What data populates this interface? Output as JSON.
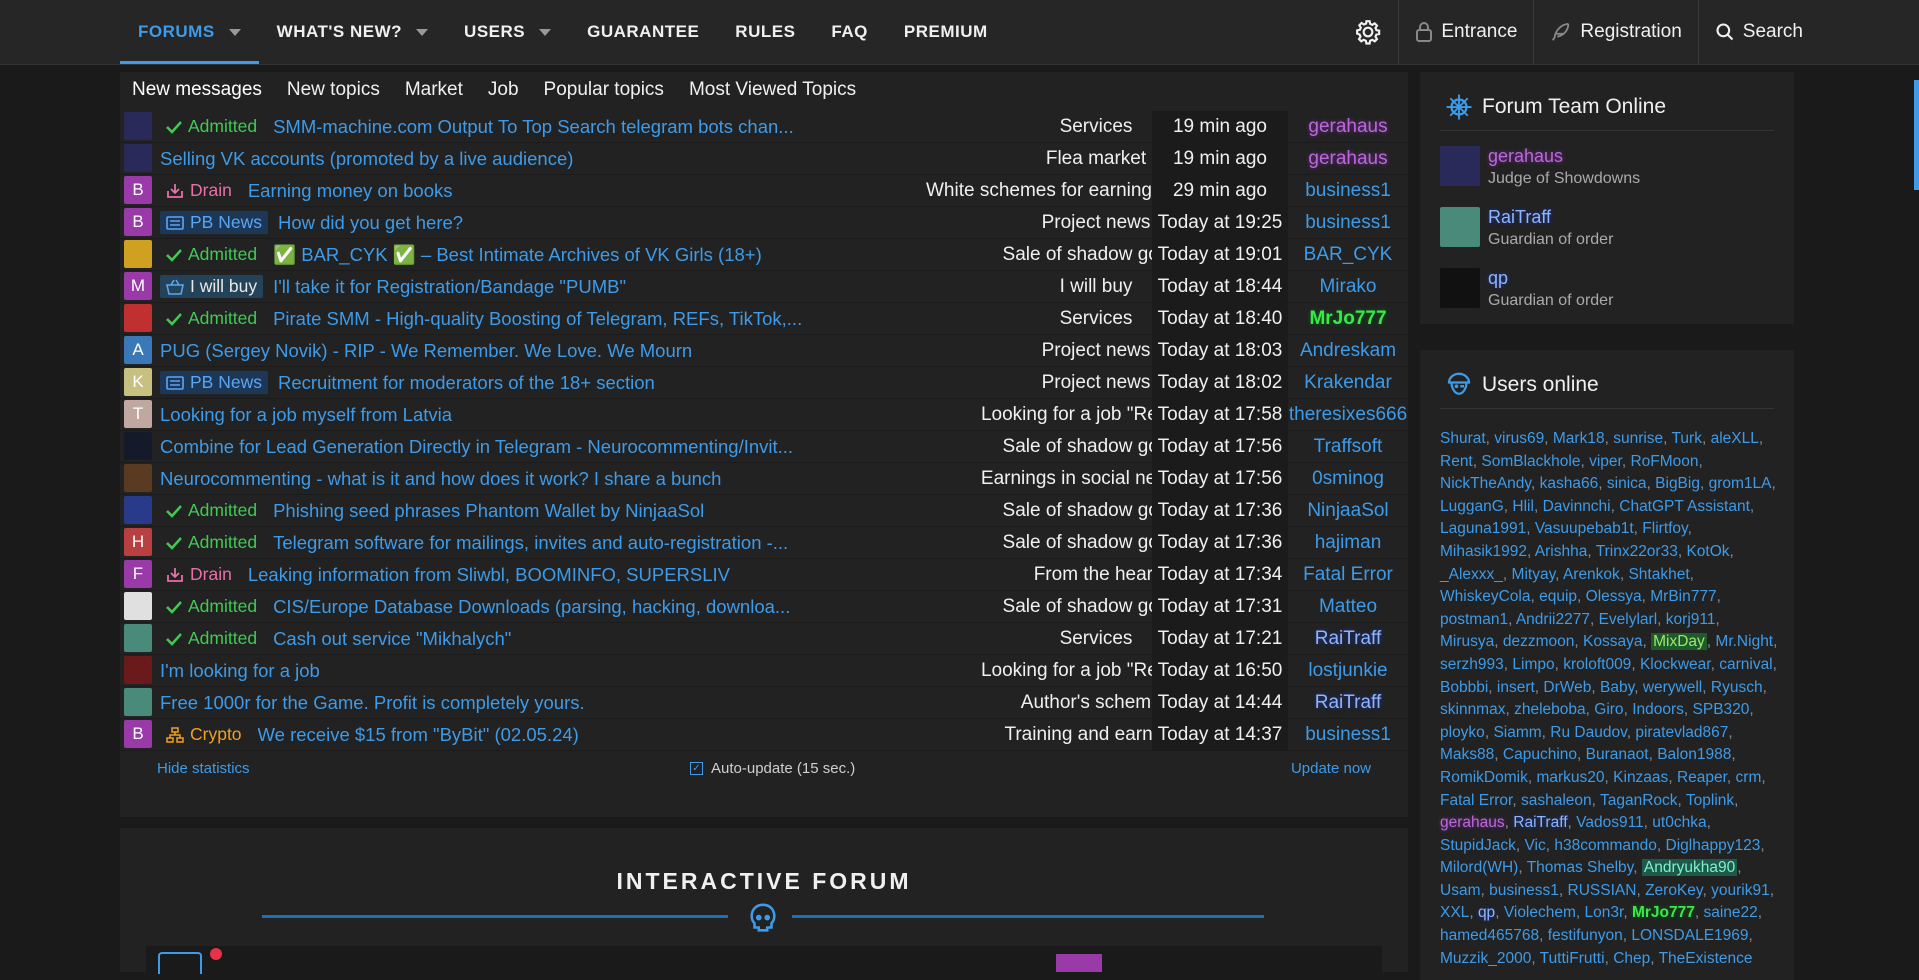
{
  "nav": {
    "items": [
      {
        "label": "FORUMS",
        "caret": true,
        "active": true
      },
      {
        "label": "WHAT'S NEW?",
        "caret": true
      },
      {
        "label": "USERS",
        "caret": true
      },
      {
        "label": "GUARANTEE"
      },
      {
        "label": "RULES"
      },
      {
        "label": "FAQ"
      },
      {
        "label": "PREMIUM"
      }
    ],
    "entrance": "Entrance",
    "registration": "Registration",
    "search": "Search"
  },
  "tabs": [
    "New messages",
    "New topics",
    "Market",
    "Job",
    "Popular topics",
    "Most Viewed Topics"
  ],
  "threads": [
    {
      "avatar": "",
      "avatar_color": "#2a2a5a",
      "prefix": "Admitted",
      "prefix_type": "admitted",
      "title": "SMM-machine.com Output To Top Search telegram bots chan...",
      "forum": "Services",
      "time": "19 min ago",
      "user": "gerahaus",
      "user_style": "purple"
    },
    {
      "avatar": "",
      "avatar_color": "#2a2a5a",
      "prefix": "",
      "prefix_type": "",
      "title": "Selling VK accounts (promoted by a live audience)",
      "forum": "Flea market",
      "time": "19 min ago",
      "user": "gerahaus",
      "user_style": "purple"
    },
    {
      "avatar": "B",
      "avatar_color": "#9a3aa8",
      "prefix": "Drain",
      "prefix_type": "drain",
      "title": "Earning money on books",
      "forum": "White schemes for earning money online",
      "time": "29 min ago",
      "user": "business1",
      "user_style": ""
    },
    {
      "avatar": "B",
      "avatar_color": "#9a3aa8",
      "prefix": "PB News",
      "prefix_type": "pb",
      "title": "How did you get here?",
      "forum": "Project news",
      "time": "Today at 19:25",
      "user": "business1",
      "user_style": ""
    },
    {
      "avatar": "",
      "avatar_color": "#d0a020",
      "prefix": "Admitted",
      "prefix_type": "admitted",
      "title": "✅ BAR_CYK ✅ – Best Intimate Archives of VK Girls (18+)",
      "forum": "Sale of shadow goods",
      "time": "Today at 19:01",
      "user": "BAR_CYK",
      "user_style": ""
    },
    {
      "avatar": "M",
      "avatar_color": "#9a3aa8",
      "prefix": "I will buy",
      "prefix_type": "buy",
      "title": "I'll take it for Registration/Bandage \"PUMB\"",
      "forum": "I will buy",
      "time": "Today at 18:44",
      "user": "Mirako",
      "user_style": ""
    },
    {
      "avatar": "",
      "avatar_color": "#c03030",
      "prefix": "Admitted",
      "prefix_type": "admitted",
      "title": "Pirate SMM - High-quality Boosting of Telegram, REFs, TikTok,...",
      "forum": "Services",
      "time": "Today at 18:40",
      "user": "MrJo777",
      "user_style": "green"
    },
    {
      "avatar": "A",
      "avatar_color": "#3a78b8",
      "prefix": "",
      "prefix_type": "",
      "title": "PUG (Sergey Novik) - RIP - We Remember. We Love. We Mourn",
      "forum": "Project news",
      "time": "Today at 18:03",
      "user": "Andreskam",
      "user_style": ""
    },
    {
      "avatar": "K",
      "avatar_color": "#c8c080",
      "prefix": "PB News",
      "prefix_type": "pb",
      "title": "Recruitment for moderators of the 18+ section",
      "forum": "Project news",
      "time": "Today at 18:02",
      "user": "Krakendar",
      "user_style": ""
    },
    {
      "avatar": "T",
      "avatar_color": "#c0a8a0",
      "prefix": "",
      "prefix_type": "",
      "title": "Looking for a job myself from Latvia",
      "forum": "Looking for a job \"Resume\"",
      "time": "Today at 17:58",
      "user": "theresixes666",
      "user_style": ""
    },
    {
      "avatar": "",
      "avatar_color": "#151a2a",
      "prefix": "",
      "prefix_type": "",
      "title": "Combine for Lead Generation Directly in Telegram - Neurocommenting/Invit...",
      "forum": "Sale of shadow goods",
      "time": "Today at 17:56",
      "user": "Traffsoft",
      "user_style": ""
    },
    {
      "avatar": "",
      "avatar_color": "#5a3a20",
      "prefix": "",
      "prefix_type": "",
      "title": "Neurocommenting - what is it and how does it work? I share a bunch",
      "forum": "Earnings in social networks",
      "time": "Today at 17:56",
      "user": "0sminog",
      "user_style": ""
    },
    {
      "avatar": "",
      "avatar_color": "#2a3a8a",
      "prefix": "Admitted",
      "prefix_type": "admitted",
      "title": "Phishing seed phrases Phantom Wallet by NinjaaSol",
      "forum": "Sale of shadow goods",
      "time": "Today at 17:36",
      "user": "NinjaaSol",
      "user_style": ""
    },
    {
      "avatar": "H",
      "avatar_color": "#b84040",
      "prefix": "Admitted",
      "prefix_type": "admitted",
      "title": "Telegram software for mailings, invites and auto-registration -...",
      "forum": "Sale of shadow goods",
      "time": "Today at 17:36",
      "user": "hajiman",
      "user_style": ""
    },
    {
      "avatar": "F",
      "avatar_color": "#9a3aa8",
      "prefix": "Drain",
      "prefix_type": "drain",
      "title": "Leaking information from Sliwbl, BOOMINFO, SUPERSLIV",
      "forum": "From the heart",
      "time": "Today at 17:34",
      "user": "Fatal Error",
      "user_style": ""
    },
    {
      "avatar": "",
      "avatar_color": "#e0e0e0",
      "prefix": "Admitted",
      "prefix_type": "admitted",
      "title": "CIS/Europe Database Downloads (parsing, hacking, downloa...",
      "forum": "Sale of shadow goods",
      "time": "Today at 17:31",
      "user": "Matteo",
      "user_style": ""
    },
    {
      "avatar": "",
      "avatar_color": "#4a8a7a",
      "prefix": "Admitted",
      "prefix_type": "admitted",
      "title": "Cash out service \"Mikhalych\"",
      "forum": "Services",
      "time": "Today at 17:21",
      "user": "RaiTraff",
      "user_style": "navy"
    },
    {
      "avatar": "",
      "avatar_color": "#6a1a1a",
      "prefix": "",
      "prefix_type": "",
      "title": "I'm looking for a job",
      "forum": "Looking for a job \"Resume\"",
      "time": "Today at 16:50",
      "user": "lostjunkie",
      "user_style": ""
    },
    {
      "avatar": "",
      "avatar_color": "#4a8a7a",
      "prefix": "",
      "prefix_type": "",
      "title": "Free 1000r for the Game. Profit is completely yours.",
      "forum": "Author's schemes",
      "time": "Today at 14:44",
      "user": "RaiTraff",
      "user_style": "navy"
    },
    {
      "avatar": "B",
      "avatar_color": "#9a3aa8",
      "prefix": "Crypto",
      "prefix_type": "crypto",
      "title": "We receive $15 from \"ByBit\" (02.05.24)",
      "forum": "Training and earnings",
      "time": "Today at 14:37",
      "user": "business1",
      "user_style": ""
    }
  ],
  "stats": {
    "hide": "Hide statistics",
    "auto_update": "Auto-update (15 sec.)",
    "update_now": "Update now"
  },
  "interactive": {
    "heading": "INTERACTIVE FORUM"
  },
  "team": {
    "title": "Forum Team Online",
    "members": [
      {
        "name": "gerahaus",
        "role": "Judge of Showdowns",
        "style": "purple",
        "avatar_color": "#2a2a5a"
      },
      {
        "name": "RaiTraff",
        "role": "Guardian of order",
        "style": "navy",
        "avatar_color": "#4a8a7a"
      },
      {
        "name": "qp",
        "role": "Guardian of order",
        "style": "navy",
        "avatar_color": "#111111"
      }
    ]
  },
  "online": {
    "title": "Users online",
    "users": [
      "Shurat",
      "virus69",
      "Mark18",
      "sunrise",
      "Turk",
      "aleXLL",
      "Rent",
      "SomBlackhole",
      "viper",
      "RoFMoon",
      "NickTheAndy",
      "kasha66",
      "sinica",
      "BigBig",
      "grom1LA",
      "LugganG",
      "Hlil",
      "Davinnchi",
      "ChatGPT Assistant",
      "Laguna1991",
      "Vasuupebab1t",
      "Flirtfoy",
      "Mihasik1992",
      "Arishha",
      "Trinx22or33",
      "KotOk",
      "_Alexxx_",
      "Mityay",
      "Arenkok",
      "Shtakhet",
      "WhiskeyCola",
      "equip",
      "Olessya",
      "MrBin777",
      "postman1",
      "Andrii2277",
      "Evelylarl",
      "korj911",
      "Mirusya",
      "dezzmoon",
      "Kossaya",
      "MixDay",
      "Mr.Night",
      "serzh993",
      "Limpo",
      "kroloft009",
      "Klockwear",
      "carnival",
      "Bobbbi",
      "insert",
      "DrWeb",
      "Baby",
      "werywell",
      "Ryusch",
      "skinnmax",
      "zheleboba",
      "Giro",
      "Indoors",
      "SPB320",
      "ployko",
      "Siamm",
      "Ru Daudov",
      "piratevlad867",
      "Maks88",
      "Capuchino",
      "Buranaot",
      "Balon1988",
      "RomikDomik",
      "markus20",
      "Kinzaas",
      "Reaper",
      "crm",
      "Fatal Error",
      "sashaleon",
      "TaganRock",
      "Toplink",
      "gerahaus",
      "RaiTraff",
      "Vados911",
      "ut0chka",
      "StupidJack",
      "Vic",
      "h38commando",
      "Diglhappy123",
      "Milord(WH)",
      "Thomas Shelby",
      "Andryukha90",
      "Usam",
      "business1",
      "RUSSIAN",
      "ZeroKey",
      "yourik91",
      "XXL",
      "qp",
      "Violechem",
      "Lon3r",
      "MrJo777",
      "saine22",
      "hamed465768",
      "festifunyon",
      "LONSDALE1969",
      "Muzzik_2000",
      "TuttiFrutti",
      "Chep",
      "TheExistence"
    ],
    "styled": {
      "MixDay": "mix",
      "gerahaus": "purple",
      "RaiTraff": "navy",
      "Andryukha90": "andr",
      "qp": "navy",
      "MrJo777": "green"
    }
  },
  "colors": {
    "accent": "#3d9be9",
    "admitted": "#3ecb52",
    "drain": "#e86fa8",
    "crypto": "#f0a020",
    "background": "#1a1a1a",
    "panel": "#222222"
  }
}
